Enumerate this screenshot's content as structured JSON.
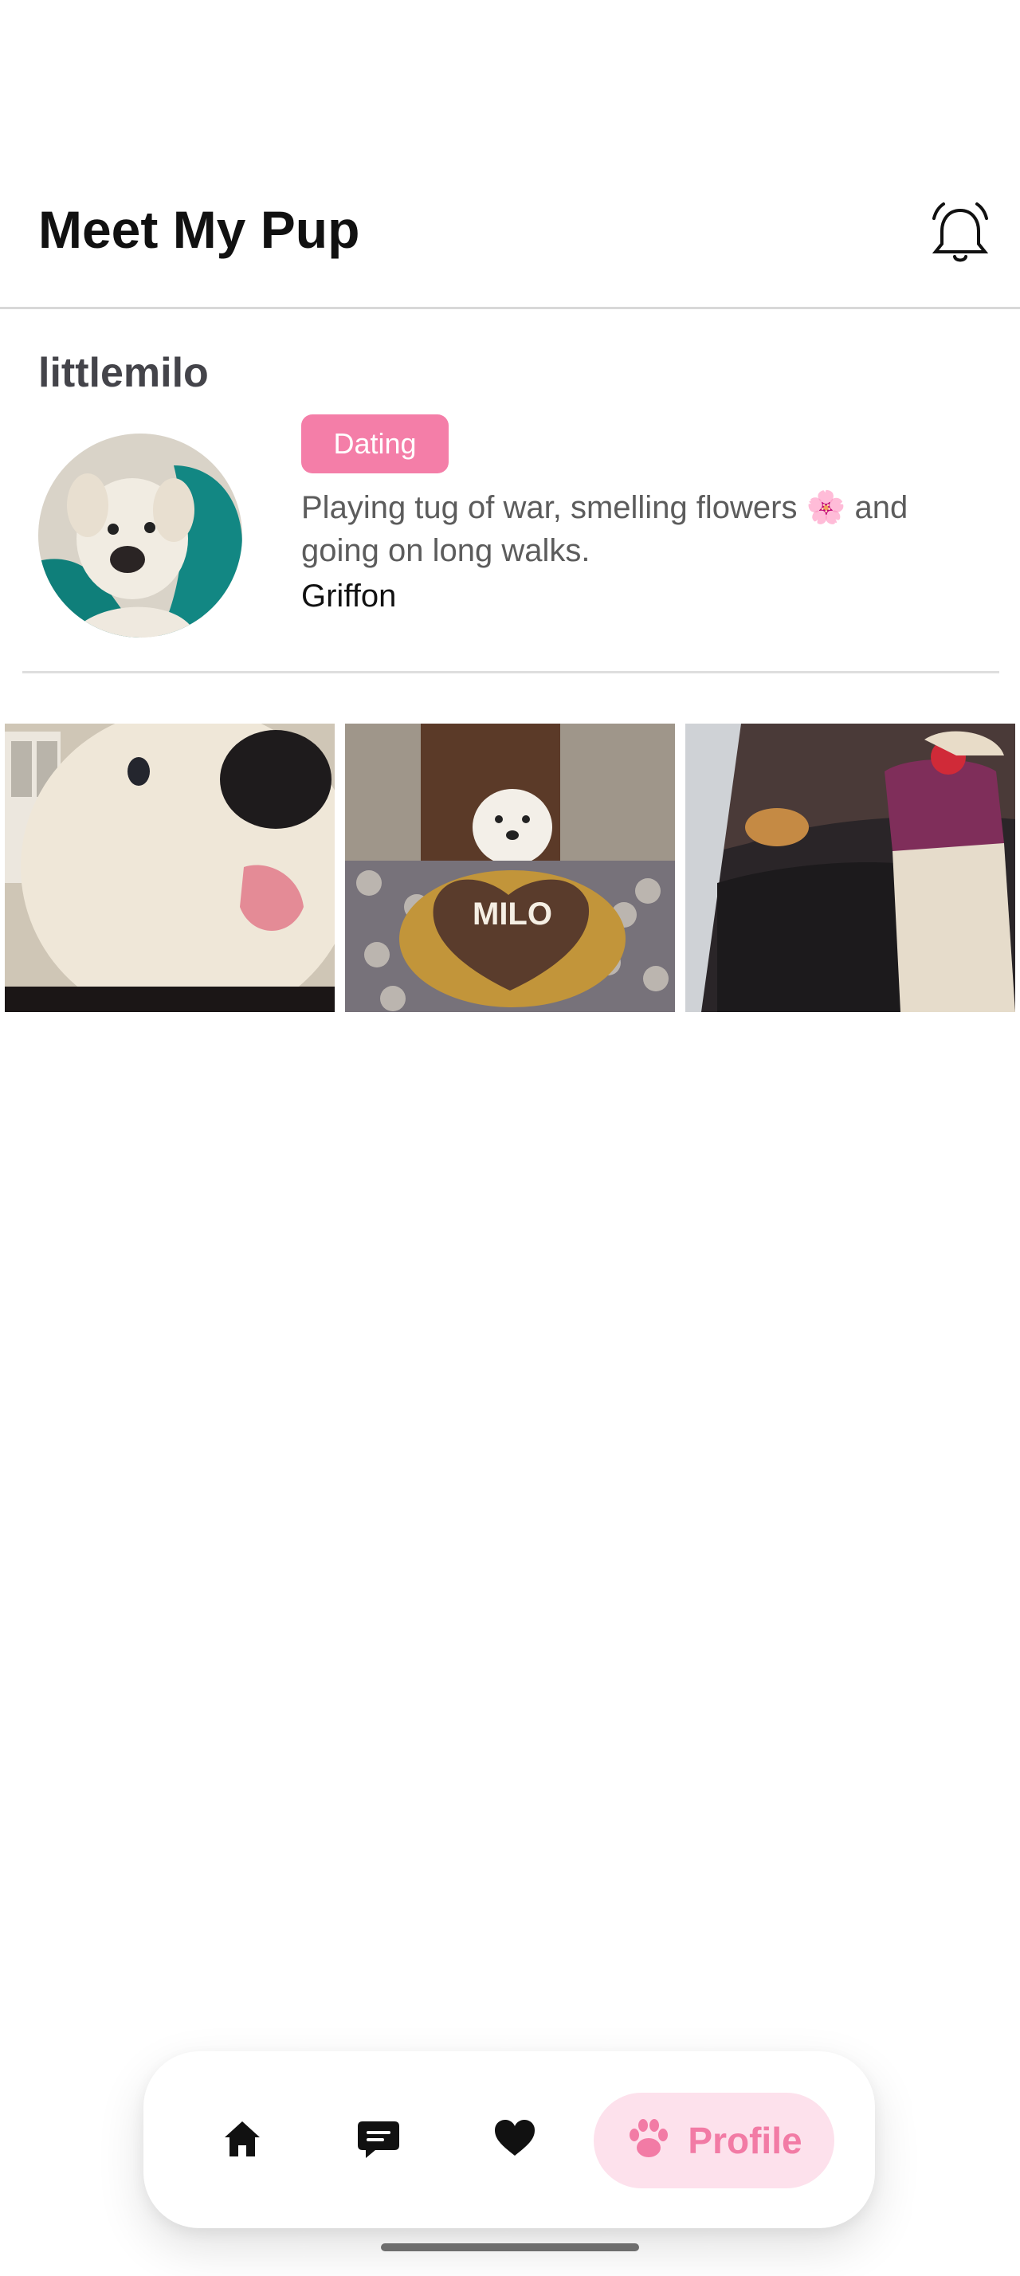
{
  "header": {
    "title": "Meet My Pup",
    "notification_icon": "bell-icon"
  },
  "profile": {
    "username": "littlemilo",
    "status_badge": "Dating",
    "bio": "Playing tug of war, smelling flowers 🌸 and going on long walks.",
    "breed": "Griffon"
  },
  "gallery": {
    "photos": [
      "dog-closeup-photo",
      "birthday-cake-photo",
      "car-hoodie-photo"
    ],
    "cake_text": "MILO"
  },
  "nav": {
    "items": [
      "home-icon",
      "chat-icon",
      "heart-icon"
    ],
    "active_label": "Profile",
    "active_icon": "paw-icon"
  },
  "colors": {
    "accent": "#f47ea8",
    "accent_soft": "#fde1ec",
    "text_dark": "#111111",
    "text_muted": "#5c5c5c"
  }
}
